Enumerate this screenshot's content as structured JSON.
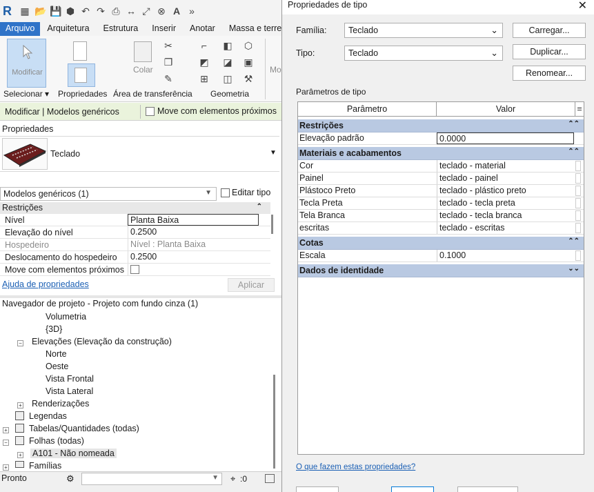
{
  "app": {
    "logo": "R"
  },
  "menu": [
    "Arquivo",
    "Arquitetura",
    "Estrutura",
    "Inserir",
    "Anotar",
    "Massa e terreno"
  ],
  "ribbon": {
    "modify_label": "Modificar",
    "color_label": "Colar",
    "modify_partial": "Mo",
    "panels": [
      "Selecionar ▾",
      "Propriedades",
      "Área de transferência",
      "Geometria"
    ]
  },
  "context_bar": {
    "title": "Modificar | Modelos genéricos",
    "checkbox_label": "Move com elementos próximos"
  },
  "properties": {
    "title": "Propriedades",
    "type_name": "Teclado",
    "selector": "Modelos genéricos (1)",
    "edit_type_label": "Editar tipo",
    "section": "Restrições",
    "rows": [
      {
        "key": "Nível",
        "value": "Planta Baixa"
      },
      {
        "key": "Elevação do nível",
        "value": "0.2500"
      },
      {
        "key": "Hospedeiro",
        "value": "Nível : Planta Baixa"
      },
      {
        "key": "Deslocamento do hospedeiro",
        "value": "0.2500"
      },
      {
        "key": "Move com elementos próximos",
        "value": ""
      }
    ],
    "help_link": "Ajuda de propriedades",
    "apply_label": "Aplicar"
  },
  "browser": {
    "title": "Navegador de projeto - Projeto com fundo cinza (1)",
    "nodes": [
      "Volumetria",
      "{3D}",
      "Elevações (Elevação da construção)",
      "Norte",
      "Oeste",
      "Vista Frontal",
      "Vista Lateral",
      "Renderizações",
      "Legendas",
      "Tabelas/Quantidades (todas)",
      "Folhas (todas)",
      "A101 - Não nomeada",
      "Famílias"
    ]
  },
  "status": {
    "text": "Pronto",
    "filter_count": ":0"
  },
  "dialog": {
    "title": "Propriedades de tipo",
    "family_label": "Família:",
    "family_value": "Teclado",
    "type_label": "Tipo:",
    "type_value": "Teclado",
    "load_label": "Carregar...",
    "duplicate_label": "Duplicar...",
    "rename_label": "Renomear...",
    "params_label": "Parâmetros de tipo",
    "col_param": "Parâmetro",
    "col_value": "Valor",
    "col_eq": "=",
    "sections": [
      {
        "name": "Restrições",
        "rows": [
          {
            "key": "Elevação padrão",
            "value": "0.0000"
          }
        ]
      },
      {
        "name": "Materiais e acabamentos",
        "rows": [
          {
            "key": "Cor",
            "value": "teclado - material"
          },
          {
            "key": "Painel",
            "value": "teclado - painel"
          },
          {
            "key": "Plástoco Preto",
            "value": "teclado - plástico preto"
          },
          {
            "key": "Tecla Preta",
            "value": "teclado - tecla preta"
          },
          {
            "key": "Tela Branca",
            "value": "teclado - tecla branca"
          },
          {
            "key": "escritas",
            "value": "teclado - escritas"
          }
        ]
      },
      {
        "name": "Cotas",
        "rows": [
          {
            "key": "Escala",
            "value": "0.1000"
          }
        ]
      },
      {
        "name": "Dados de identidade",
        "rows": []
      }
    ],
    "help_link": "O que fazem estas propriedades?"
  },
  "colors": {
    "accent": "#2f73c8",
    "section": "#b9c9e2",
    "context": "#eaf3dc"
  }
}
